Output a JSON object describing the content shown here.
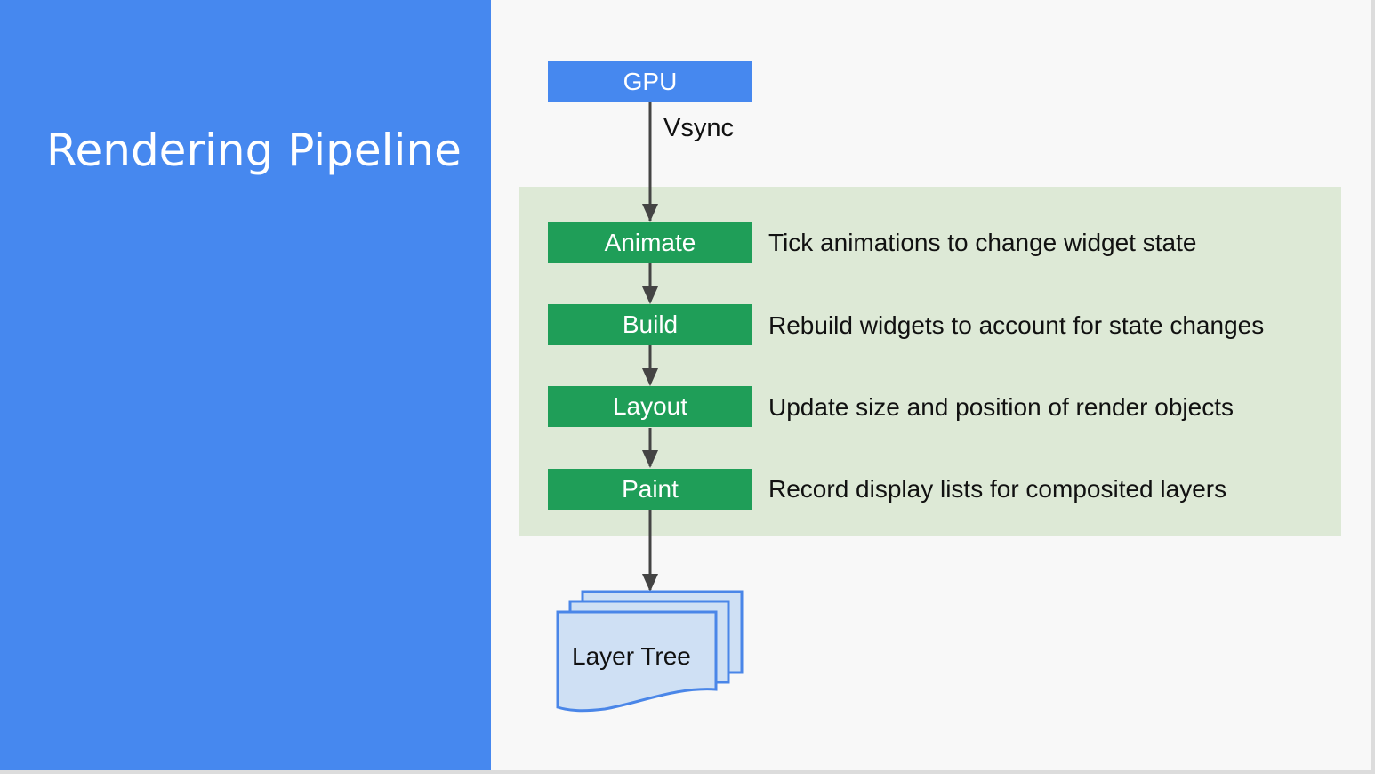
{
  "slide": {
    "title": "Rendering Pipeline",
    "colors": {
      "left_panel": "#4688ef",
      "gpu_box": "#4688ef",
      "stage_box": "#1f9e58",
      "stage_area": "#dde9d6",
      "layer_tree_fill": "#cfe0f4",
      "layer_tree_stroke": "#4a86e8",
      "arrow": "#444444"
    }
  },
  "diagram": {
    "source": {
      "label": "GPU"
    },
    "signal_label": "Vsync",
    "stages": [
      {
        "label": "Animate",
        "description": "Tick animations to change widget state"
      },
      {
        "label": "Build",
        "description": "Rebuild widgets to account for state changes"
      },
      {
        "label": "Layout",
        "description": "Update size and position of render objects"
      },
      {
        "label": "Paint",
        "description": "Record display lists for composited layers"
      }
    ],
    "output": {
      "label": "Layer Tree"
    }
  }
}
